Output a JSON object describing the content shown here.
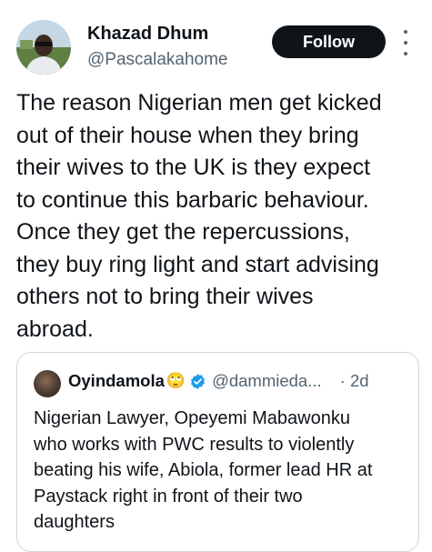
{
  "author": {
    "name": "Khazad Dhum",
    "handle": "@Pascalakahome"
  },
  "follow_label": "Follow",
  "tweet_lines": [
    "The reason Nigerian men get kicked",
    "out of their house when they bring",
    "their wives to the UK is they expect",
    "to continue this barbaric behaviour.",
    "Once they get the repercussions,",
    "they buy ring light and start advising",
    "others not to bring their wives",
    "abroad."
  ],
  "quote": {
    "name": "Oyindamola",
    "emoji": "🙄",
    "handle": "@dammieda...",
    "time": "· 2d",
    "verified_color": "#1d9bf0",
    "lines": [
      "Nigerian Lawyer, Opeyemi Mabawonku",
      "who works with PWC results to violently",
      "beating his wife, Abiola, former lead HR at",
      "Paystack right in front of their two",
      "daughters"
    ]
  }
}
